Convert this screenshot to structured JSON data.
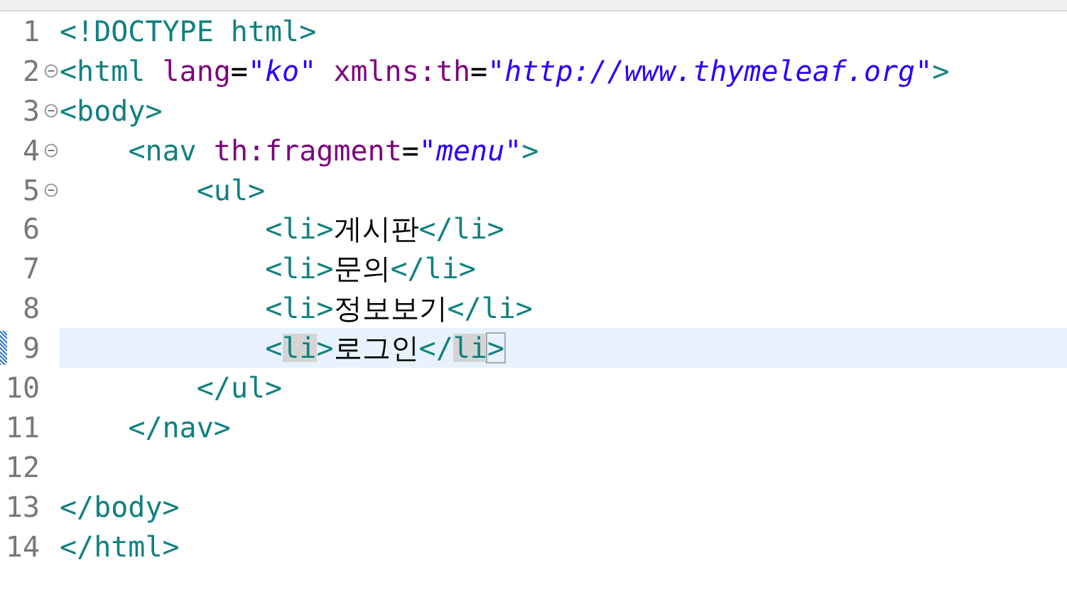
{
  "editor": {
    "lines": [
      {
        "number": "1",
        "fold": false,
        "current": false,
        "marker": false,
        "tokens": [
          {
            "kind": "tag",
            "text": "<!DOCTYPE html>"
          }
        ]
      },
      {
        "number": "2",
        "fold": true,
        "current": false,
        "marker": false,
        "tokens": [
          {
            "kind": "tag",
            "text": "<html "
          },
          {
            "kind": "attr",
            "text": "lang"
          },
          {
            "kind": "plain",
            "text": "="
          },
          {
            "kind": "value",
            "text": "\"ko\" "
          },
          {
            "kind": "attr",
            "text": "xmlns:th"
          },
          {
            "kind": "plain",
            "text": "="
          },
          {
            "kind": "value",
            "text": "\"http://www.thymeleaf.org\""
          },
          {
            "kind": "tag",
            "text": ">"
          }
        ]
      },
      {
        "number": "3",
        "fold": true,
        "current": false,
        "marker": false,
        "tokens": [
          {
            "kind": "tag",
            "text": "<body>"
          }
        ],
        "children": [
          {
            "number": "4",
            "fold": true,
            "current": false,
            "marker": false,
            "tokens": [
              {
                "kind": "tag",
                "text": "<nav "
              },
              {
                "kind": "attr",
                "text": "th:fragment"
              },
              {
                "kind": "plain",
                "text": "="
              },
              {
                "kind": "value",
                "text": "\"menu\""
              },
              {
                "kind": "tag",
                "text": ">"
              }
            ],
            "children": [
              {
                "number": "5",
                "fold": true,
                "current": false,
                "marker": false,
                "tokens": [
                  {
                    "kind": "tag",
                    "text": "<ul>"
                  }
                ],
                "children": [
                  {
                    "number": "6",
                    "fold": false,
                    "current": false,
                    "marker": false,
                    "tokens": [
                      {
                        "kind": "tag",
                        "text": "<li>"
                      },
                      {
                        "kind": "text",
                        "text": "게시판"
                      },
                      {
                        "kind": "tag",
                        "text": "</li>"
                      }
                    ]
                  },
                  {
                    "number": "7",
                    "fold": false,
                    "current": false,
                    "marker": false,
                    "tokens": [
                      {
                        "kind": "tag",
                        "text": "<li>"
                      },
                      {
                        "kind": "text",
                        "text": "문의"
                      },
                      {
                        "kind": "tag",
                        "text": "</li>"
                      }
                    ]
                  },
                  {
                    "number": "8",
                    "fold": false,
                    "current": false,
                    "marker": false,
                    "tokens": [
                      {
                        "kind": "tag",
                        "text": "<li>"
                      },
                      {
                        "kind": "text",
                        "text": "정보보기"
                      },
                      {
                        "kind": "tag",
                        "text": "</li>"
                      }
                    ]
                  },
                  {
                    "number": "9",
                    "fold": false,
                    "current": true,
                    "marker": true,
                    "tokens": [
                      {
                        "kind": "tag",
                        "text": "<"
                      },
                      {
                        "kind": "match",
                        "text": "li"
                      },
                      {
                        "kind": "tag",
                        "text": ">"
                      },
                      {
                        "kind": "text",
                        "text": "로그인"
                      },
                      {
                        "kind": "tag",
                        "text": "</"
                      },
                      {
                        "kind": "match",
                        "text": "li"
                      },
                      {
                        "kind": "caret",
                        "text": ">"
                      }
                    ]
                  }
                ]
              },
              {
                "number": "10",
                "fold": false,
                "current": false,
                "marker": false,
                "tokens": [
                  {
                    "kind": "tag",
                    "text": "</ul>"
                  }
                ]
              }
            ]
          },
          {
            "number": "11",
            "fold": false,
            "current": false,
            "marker": false,
            "tokens": [
              {
                "kind": "tag",
                "text": "</nav>"
              }
            ]
          }
        ]
      },
      {
        "number": "12",
        "fold": false,
        "current": false,
        "marker": false
      },
      {
        "number": "13",
        "fold": false,
        "current": false,
        "marker": false,
        "tokens": [
          {
            "kind": "tag",
            "text": "</body>"
          }
        ]
      },
      {
        "number": "14",
        "fold": false,
        "current": false,
        "marker": false,
        "tokens": [
          {
            "kind": "tag",
            "text": "</html>"
          }
        ]
      }
    ]
  }
}
